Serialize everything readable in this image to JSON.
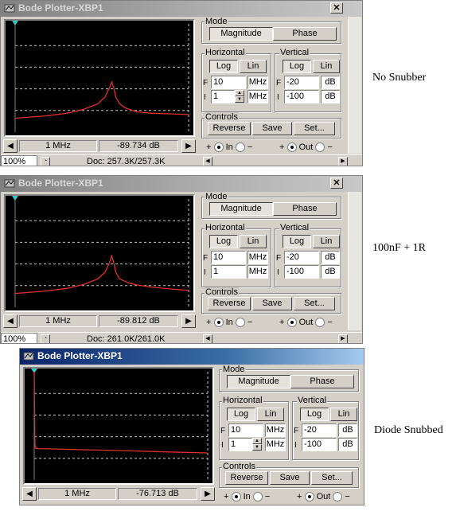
{
  "colors": {
    "trace": "#e0302f",
    "grid": "#c8c8c8",
    "screen_bg": "#000000",
    "cursor": "#36c8c8",
    "title_active": "#0a246a"
  },
  "controls": {
    "mode_label": "Mode",
    "magnitude": "Magnitude",
    "phase": "Phase",
    "horizontal_label": "Horizontal",
    "vertical_label": "Vertical",
    "log": "Log",
    "lin": "Lin",
    "F": "F",
    "I": "I",
    "controls_label": "Controls",
    "reverse": "Reverse",
    "save": "Save",
    "set": "Set...",
    "in": "In",
    "out": "Out",
    "plus": "+",
    "minus": "−"
  },
  "windows": [
    {
      "title": "Bode Plotter-XBP1",
      "active": false,
      "h_final": "10",
      "h_final_unit": "MHz",
      "h_initial": "1",
      "h_initial_unit": "MHz",
      "v_final": "-20",
      "v_final_unit": "dB",
      "v_initial": "-100",
      "v_initial_unit": "dB",
      "readout_freq": "1 MHz",
      "readout_mag": "-89.734 dB",
      "zoom": "100%",
      "doc": "Doc: 257.3K/257.3K",
      "note": "No Snubber"
    },
    {
      "title": "Bode Plotter-XBP1",
      "active": false,
      "h_final": "10",
      "h_final_unit": "MHz",
      "h_initial": "1",
      "h_initial_unit": "MHz",
      "v_final": "-20",
      "v_final_unit": "dB",
      "v_initial": "-100",
      "v_initial_unit": "dB",
      "readout_freq": "1 MHz",
      "readout_mag": "-89.812 dB",
      "zoom": "100%",
      "doc": "Doc: 261.0K/261.0K",
      "note": "100nF + 1R"
    },
    {
      "title": "Bode Plotter-XBP1",
      "active": true,
      "h_final": "10",
      "h_final_unit": "MHz",
      "h_initial": "1",
      "h_initial_unit": "MHz",
      "v_final": "-20",
      "v_final_unit": "dB",
      "v_initial": "-100",
      "v_initial_unit": "dB",
      "readout_freq": "1 MHz",
      "readout_mag": "-76.713 dB",
      "note": "Diode Snubbed"
    }
  ],
  "chart_data": [
    {
      "type": "line",
      "xscale": "log",
      "xlim": [
        1,
        10
      ],
      "x_unit": "MHz",
      "ylim": [
        -100,
        -20
      ],
      "y_unit": "dB",
      "grid": true,
      "series": [
        {
          "x": [
            1,
            1.5,
            2,
            2.5,
            3,
            3.3,
            3.5,
            3.6,
            3.7,
            3.8,
            4,
            4.3,
            5,
            6,
            8,
            10
          ],
          "values": [
            -89.7,
            -88,
            -86,
            -83,
            -79,
            -74,
            -67,
            -63,
            -67,
            -74,
            -79,
            -82,
            -85,
            -86,
            -86.5,
            -87
          ]
        }
      ]
    },
    {
      "type": "line",
      "xscale": "log",
      "xlim": [
        1,
        10
      ],
      "x_unit": "MHz",
      "ylim": [
        -100,
        -20
      ],
      "y_unit": "dB",
      "grid": true,
      "series": [
        {
          "x": [
            1,
            1.5,
            2,
            2.5,
            3,
            3.3,
            3.5,
            3.6,
            3.7,
            3.8,
            4,
            4.5,
            5,
            6,
            8,
            10
          ],
          "values": [
            -89.8,
            -88,
            -86,
            -83,
            -79,
            -74,
            -67,
            -62,
            -67,
            -74,
            -79,
            -82,
            -83.5,
            -85,
            -86.5,
            -87.5
          ]
        }
      ]
    },
    {
      "type": "line",
      "xscale": "log",
      "xlim": [
        1,
        10
      ],
      "x_unit": "MHz",
      "ylim": [
        -100,
        -20
      ],
      "y_unit": "dB",
      "grid": true,
      "series": [
        {
          "x": [
            1,
            1.01,
            1.02,
            1.05,
            1.2,
            1.5,
            2,
            3,
            5,
            7,
            10
          ],
          "values": [
            -20,
            -74,
            -76.7,
            -76.8,
            -77,
            -77.3,
            -77.7,
            -78.2,
            -79,
            -79.5,
            -80
          ]
        }
      ]
    }
  ]
}
